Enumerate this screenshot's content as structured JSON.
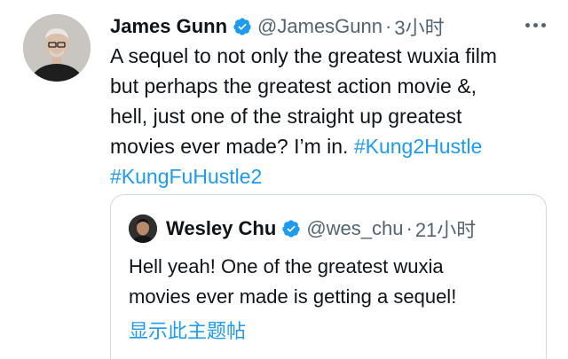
{
  "colors": {
    "link": "#1d9bf0",
    "secondary": "#536471",
    "text": "#0f1419",
    "border": "#cfd9de"
  },
  "tweet": {
    "author_name": "James Gunn",
    "handle": "@JamesGunn",
    "separator": "·",
    "time": "3小时",
    "verified_icon": "verified-badge-icon",
    "more_icon": "more-options-icon",
    "text_line1": "A sequel to not only the greatest wuxia film",
    "text_line2": "but perhaps the greatest action movie &,",
    "text_line3": "hell, just one of the straight up greatest",
    "text_line4": "movies ever made? I’m in.",
    "hashtag1": "#Kung2Hustle",
    "hashtag2": "#KungFuHustle2"
  },
  "quote": {
    "author_name": "Wesley Chu",
    "handle": "@wes_chu",
    "separator": "·",
    "time": "21小时",
    "text_line1": "Hell yeah! One of the greatest wuxia",
    "text_line2": "movies ever made is getting a sequel!",
    "show_thread": "显示此主题帖"
  }
}
